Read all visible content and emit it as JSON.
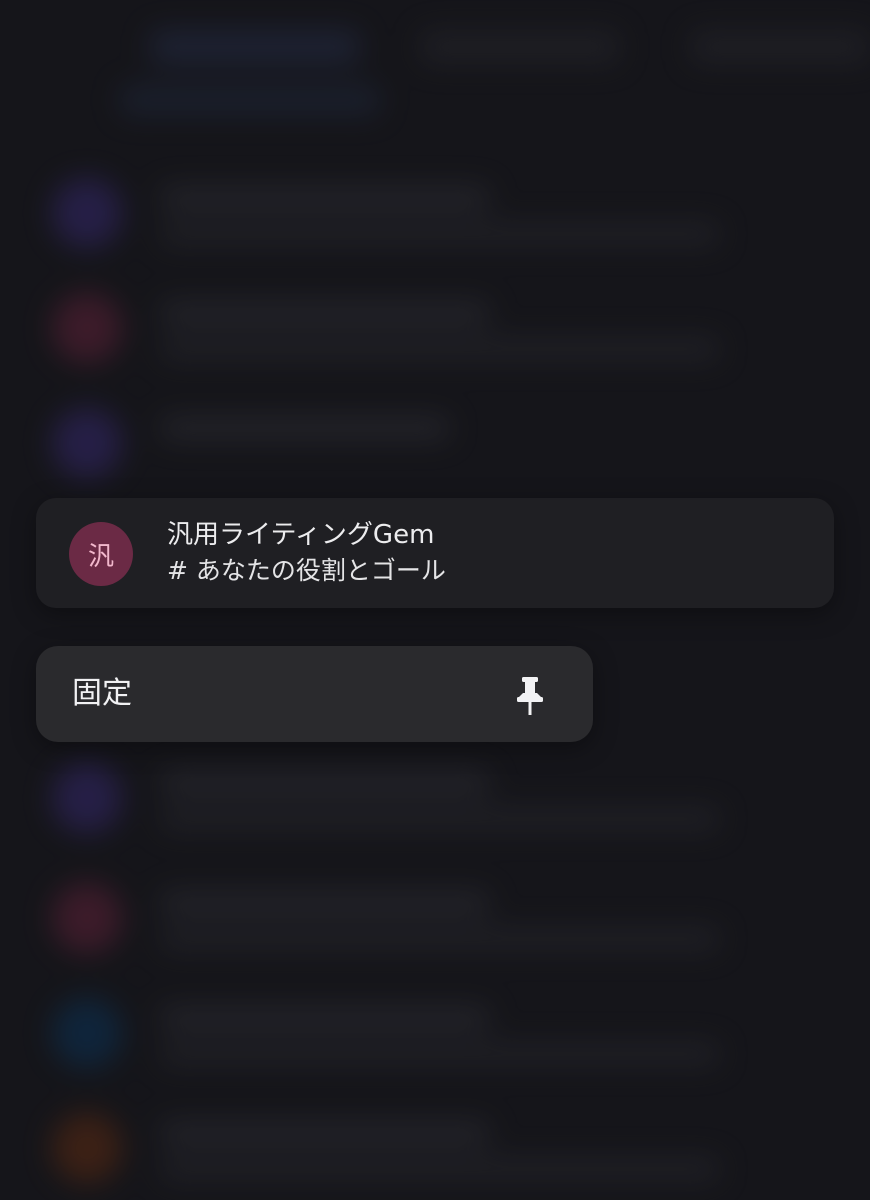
{
  "focused_conversation": {
    "avatar_char": "汎",
    "title": "汎用ライティングGem",
    "subtitle": "# あなたの役割とゴール",
    "avatar_color": "#6b2a45"
  },
  "context_menu": {
    "pin_label": "固定",
    "pin_icon": "pin-icon"
  },
  "background_avatar_colors": [
    "#3d2f7a",
    "#6b2840",
    "#3d2f7a",
    "#3d2f7a",
    "#6b2840",
    "#0f3b63",
    "#6a3216"
  ]
}
